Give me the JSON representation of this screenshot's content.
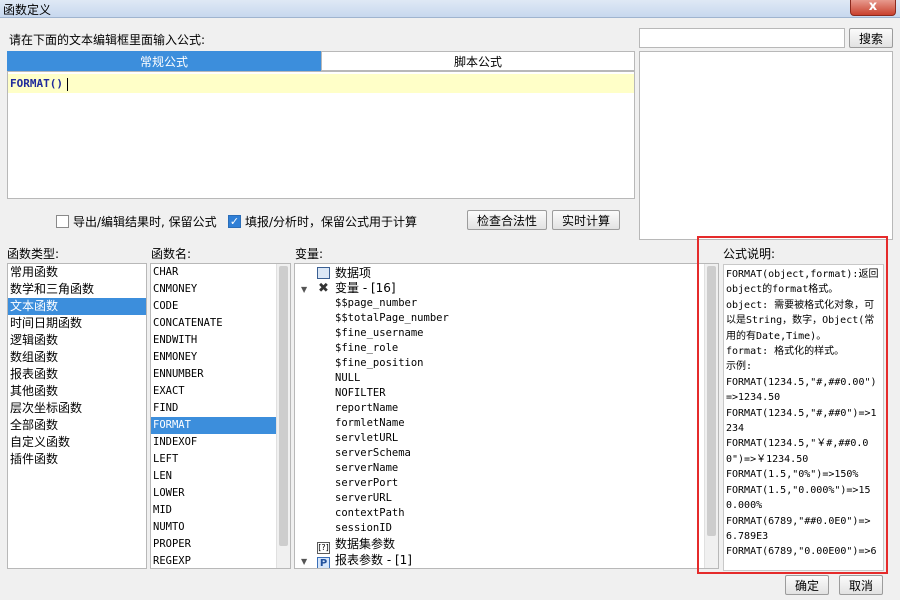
{
  "window": {
    "title": "函数定义",
    "close": "x"
  },
  "editor": {
    "prompt": "请在下面的文本编辑框里面输入公式:",
    "tabs": [
      "常规公式",
      "脚本公式"
    ],
    "content": "FORMAT()"
  },
  "search": {
    "value": "",
    "button": "搜索"
  },
  "options": {
    "keep_on_export": {
      "label": "导出/编辑结果时, 保留公式",
      "checked": false
    },
    "keep_on_fill": {
      "label": "填报/分析时，保留公式用于计算",
      "checked": true
    },
    "check_button": "检查合法性",
    "realtime_button": "实时计算"
  },
  "function_types": {
    "label": "函数类型:",
    "selected": 2,
    "items": [
      "常用函数",
      "数学和三角函数",
      "文本函数",
      "时间日期函数",
      "逻辑函数",
      "数组函数",
      "报表函数",
      "其他函数",
      "层次坐标函数",
      "全部函数",
      "自定义函数",
      "插件函数"
    ]
  },
  "function_names": {
    "label": "函数名:",
    "selected": 9,
    "items": [
      "CHAR",
      "CNMONEY",
      "CODE",
      "CONCATENATE",
      "ENDWITH",
      "ENMONEY",
      "ENNUMBER",
      "EXACT",
      "FIND",
      "FORMAT",
      "INDEXOF",
      "LEFT",
      "LEN",
      "LOWER",
      "MID",
      "NUMTO",
      "PROPER",
      "REGEXP"
    ]
  },
  "variables": {
    "label": "变量:",
    "data_item": "数据项",
    "var_group": "变量 - [16]",
    "var_items": [
      "$$page_number",
      "$$totalPage_number",
      "$fine_username",
      "$fine_role",
      "$fine_position",
      "NULL",
      "NOFILTER",
      "reportName",
      "formletName",
      "servletURL",
      "serverSchema",
      "serverName",
      "serverPort",
      "serverURL",
      "contextPath",
      "sessionID"
    ],
    "dataset_params": "数据集参数",
    "report_params": "报表参数 - [1]",
    "icons": [
      "table-icon",
      "variable-icon",
      "dataset-param-icon",
      "parameter-icon"
    ]
  },
  "description": {
    "label": "公式说明:",
    "text": "FORMAT(object,format):返回object的format格式。\nobject: 需要被格式化对象，可以是String，数字，Object(常用的有Date,Time)。\nformat: 格式化的样式。\n示例:\nFORMAT(1234.5,\"#,##0.00\")=>1234.50\nFORMAT(1234.5,\"#,##0\")=>1234\nFORMAT(1234.5,\"￥#,##0.00\")=>￥1234.50\nFORMAT(1.5,\"0%\")=>150%\nFORMAT(1.5,\"0.000%\")=>150.000%\nFORMAT(6789,\"##0.0E0\")=>6.789E3\nFORMAT(6789,\"0.00E00\")=>6"
  },
  "footer": {
    "ok": "确定",
    "cancel": "取消"
  },
  "colors": {
    "accent": "#3c8edc",
    "highlight": "#e52b2b",
    "editor_line": "#ffffc8"
  }
}
